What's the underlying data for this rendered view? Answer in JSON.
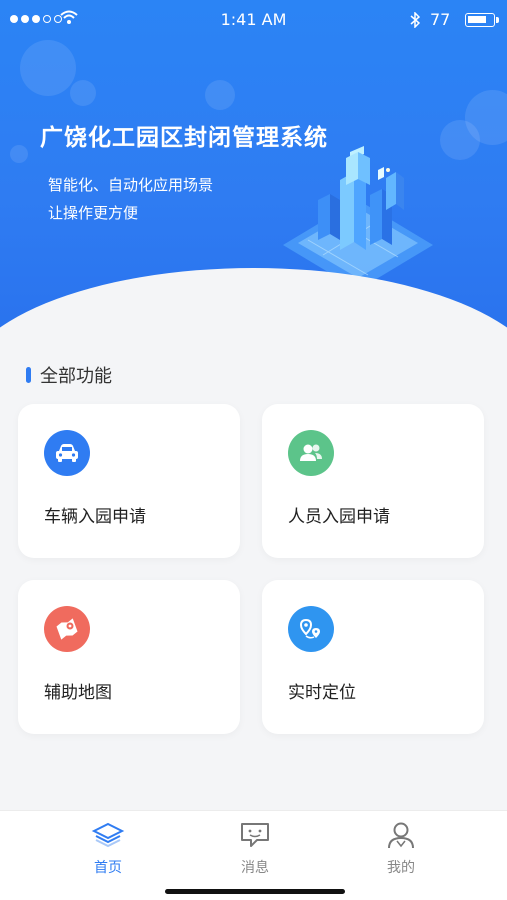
{
  "status_bar": {
    "time": "1:41 AM",
    "battery_percent": "77",
    "battery_level": 0.77,
    "signal_bars_filled": 3,
    "signal_bars_total": 5
  },
  "hero": {
    "title": "广饶化工园区封闭管理系统",
    "subtitle_line1": "智能化、自动化应用场景",
    "subtitle_line2": "让操作更方便"
  },
  "section": {
    "title": "全部功能"
  },
  "cards": [
    {
      "label": "车辆入园申请",
      "icon": "car-icon",
      "color": "#2f7cf2"
    },
    {
      "label": "人员入园申请",
      "icon": "people-icon",
      "color": "#5cc48a"
    },
    {
      "label": "辅助地图",
      "icon": "map-icon",
      "color": "#f06b5e"
    },
    {
      "label": "实时定位",
      "icon": "location-icon",
      "color": "#2f95f0"
    }
  ],
  "tabbar": {
    "tabs": [
      {
        "label": "首页",
        "icon": "home-layers-icon",
        "active": true
      },
      {
        "label": "消息",
        "icon": "message-icon",
        "active": false
      },
      {
        "label": "我的",
        "icon": "profile-icon",
        "active": false
      }
    ]
  },
  "colors": {
    "primary": "#2f7cf2",
    "background": "#f4f5f7"
  }
}
